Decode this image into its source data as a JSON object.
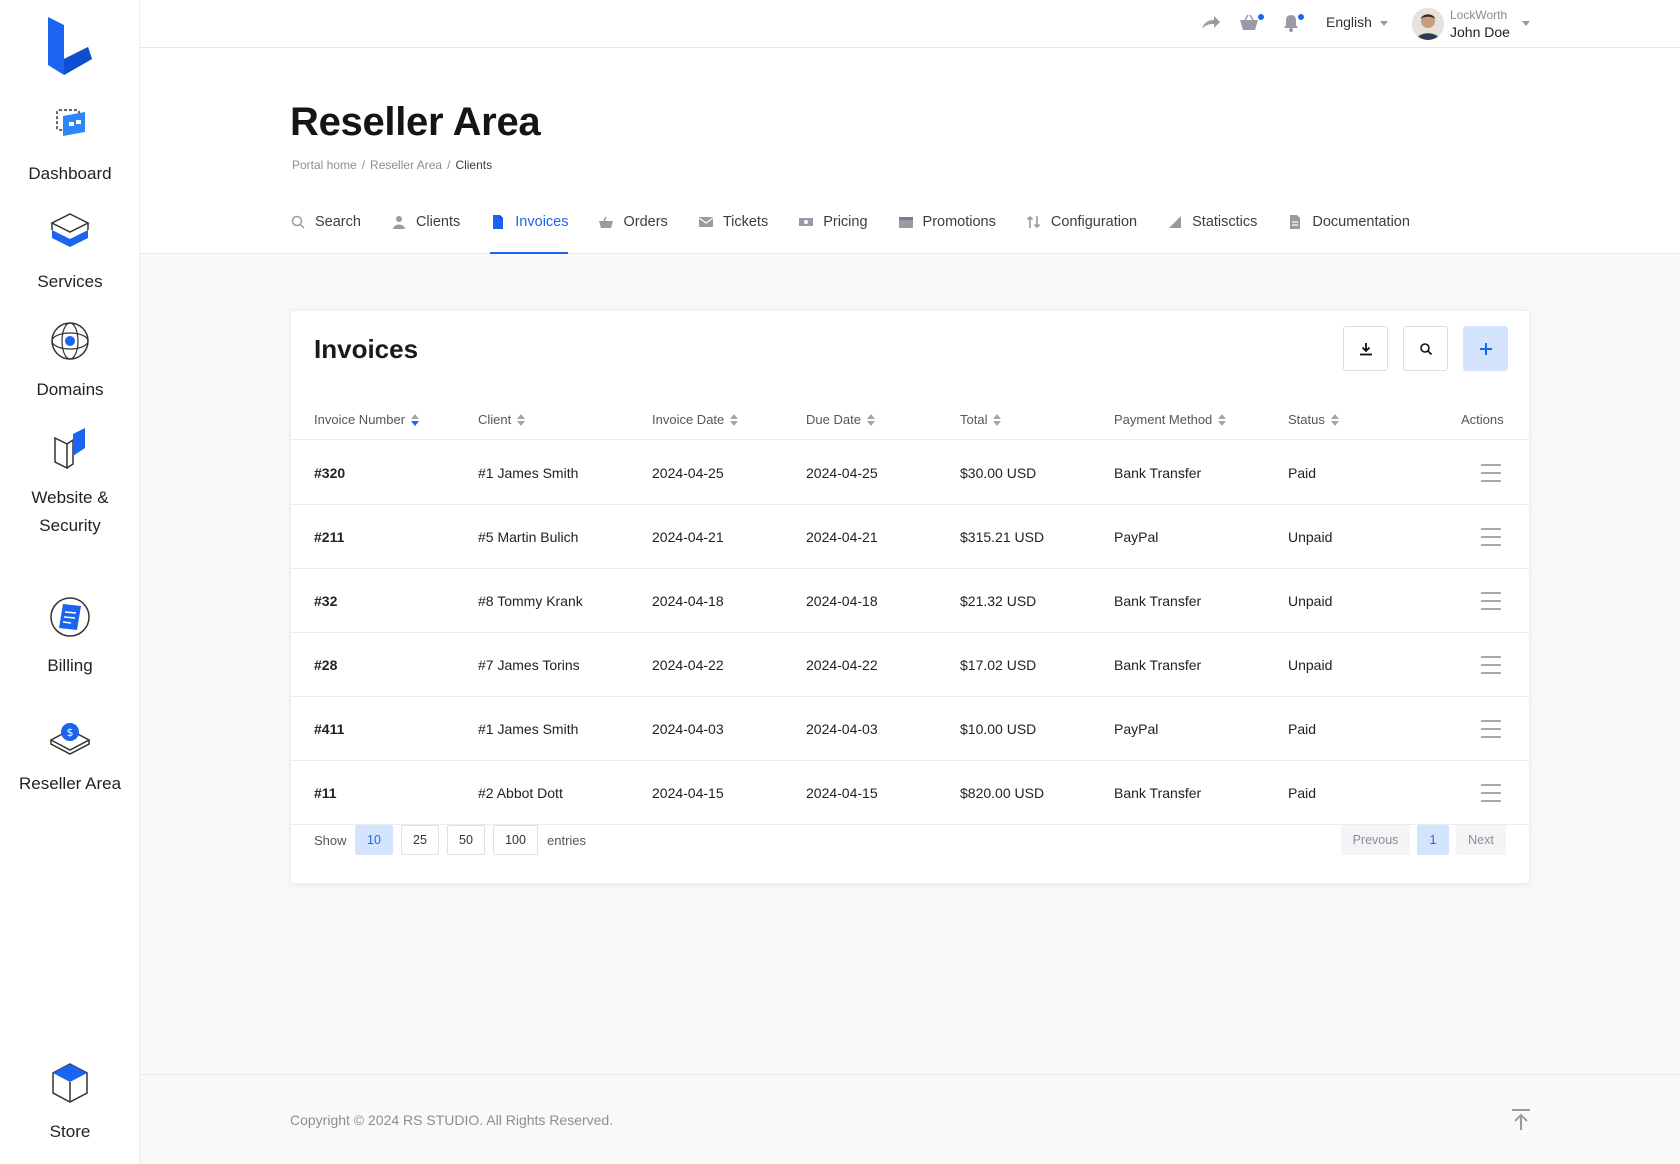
{
  "sidebar": {
    "items": [
      {
        "label": "Dashboard",
        "icon": "dashboard-icon"
      },
      {
        "label": "Services",
        "icon": "services-icon"
      },
      {
        "label": "Domains",
        "icon": "domains-icon"
      },
      {
        "label": "Website &",
        "label2": "Security",
        "icon": "website-security-icon"
      },
      {
        "label": "Billing",
        "icon": "billing-icon"
      },
      {
        "label": "Reseller Area",
        "icon": "reseller-icon"
      }
    ],
    "store": {
      "label": "Store",
      "icon": "store-icon"
    }
  },
  "topbar": {
    "language": "English",
    "user_company": "LockWorth",
    "user_name": "John Doe"
  },
  "page": {
    "title": "Reseller Area",
    "breadcrumb": [
      "Portal home",
      "Reseller Area",
      "Clients"
    ]
  },
  "tabs": [
    {
      "label": "Search",
      "icon": "search-icon"
    },
    {
      "label": "Clients",
      "icon": "user-icon"
    },
    {
      "label": "Invoices",
      "icon": "invoice-icon",
      "active": true
    },
    {
      "label": "Orders",
      "icon": "basket-icon"
    },
    {
      "label": "Tickets",
      "icon": "ticket-icon"
    },
    {
      "label": "Pricing",
      "icon": "pricing-icon"
    },
    {
      "label": "Promotions",
      "icon": "promotions-icon"
    },
    {
      "label": "Configuration",
      "icon": "configuration-icon"
    },
    {
      "label": "Statisctics",
      "icon": "statistics-icon"
    },
    {
      "label": "Documentation",
      "icon": "documentation-icon"
    }
  ],
  "invoices": {
    "title": "Invoices",
    "columns": [
      "Invoice Number",
      "Client",
      "Invoice Date",
      "Due Date",
      "Total",
      "Payment Method",
      "Status",
      "Actions"
    ],
    "rows": [
      {
        "number": "#320",
        "client": "#1 James Smith",
        "invoice_date": "2024-04-25",
        "due_date": "2024-04-25",
        "total": "$30.00 USD",
        "method": "Bank Transfer",
        "status": "Paid"
      },
      {
        "number": "#211",
        "client": "#5 Martin Bulich",
        "invoice_date": "2024-04-21",
        "due_date": "2024-04-21",
        "total": "$315.21 USD",
        "method": "PayPal",
        "status": "Unpaid"
      },
      {
        "number": "#32",
        "client": "#8 Tommy Krank",
        "invoice_date": "2024-04-18",
        "due_date": "2024-04-18",
        "total": "$21.32 USD",
        "method": "Bank Transfer",
        "status": "Unpaid"
      },
      {
        "number": "#28",
        "client": "#7 James Torins",
        "invoice_date": "2024-04-22",
        "due_date": "2024-04-22",
        "total": "$17.02 USD",
        "method": "Bank Transfer",
        "status": "Unpaid"
      },
      {
        "number": "#411",
        "client": "#1 James Smith",
        "invoice_date": "2024-04-03",
        "due_date": "2024-04-03",
        "total": "$10.00 USD",
        "method": "PayPal",
        "status": "Paid"
      },
      {
        "number": "#11",
        "client": "#2 Abbot Dott",
        "invoice_date": "2024-04-15",
        "due_date": "2024-04-15",
        "total": "$820.00 USD",
        "method": "Bank Transfer",
        "status": "Paid"
      }
    ],
    "show_label": "Show",
    "entries_label": "entries",
    "page_sizes": [
      "10",
      "25",
      "50",
      "100"
    ],
    "selected_page_size": "10",
    "prev_label": "Prevous",
    "next_label": "Next",
    "current_page": "1"
  },
  "footer": {
    "copyright": "Copyright © 2024 RS STUDIO. All Rights Reserved."
  },
  "colors": {
    "accent": "#1a64f0",
    "accent_light": "#d5e4fd"
  }
}
